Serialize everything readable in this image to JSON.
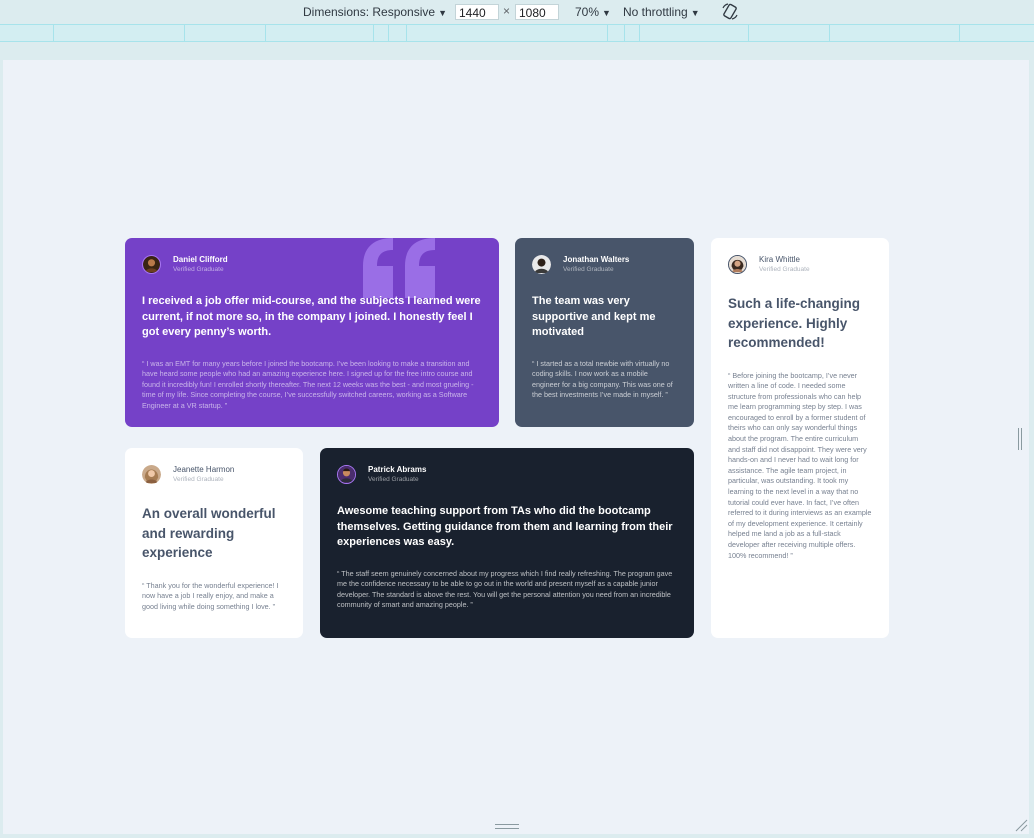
{
  "devtools": {
    "dimensions_label": "Dimensions: Responsive",
    "width_value": "1440",
    "height_value": "1080",
    "times": "×",
    "zoom": "70%",
    "throttling": "No throttling",
    "caret": "▼"
  },
  "testimonials": [
    {
      "name": "Daniel Clifford",
      "role": "Verified Graduate",
      "headline": "I received a job offer mid-course, and the subjects I learned were current, if not more so, in the company I joined. I honestly feel I got every penny’s worth.",
      "quote": "“ I was an EMT for many years before I joined the bootcamp. I’ve been looking to make a transition and have heard some people who had an amazing experience here. I signed up for the free intro course and found it incredibly fun! I enrolled shortly thereafter. The next 12 weeks was the best - and most grueling - time of my life. Since completing the course, I’ve successfully switched careers, working as a Software Engineer at a VR startup. ”"
    },
    {
      "name": "Jonathan Walters",
      "role": "Verified Graduate",
      "headline": "The team was very supportive and kept me motivated",
      "quote": "“ I started as a total newbie with virtually no coding skills. I now work as a mobile engineer for a big company. This was one of the best investments I’ve made in myself. ”"
    },
    {
      "name": "Kira Whittle",
      "role": "Verified Graduate",
      "headline": "Such a life-changing experience. Highly recommended!",
      "quote": "“ Before joining the bootcamp, I’ve never written a line of code. I needed some structure from professionals who can help me learn programming step by step. I was encouraged to enroll by a former student of theirs who can only say wonderful things about the program. The entire curriculum and staff did not disappoint. They were very hands-on and I never had to wait long for assistance. The agile team project, in particular, was outstanding. It took my learning to the next level in a way that no tutorial could ever have. In fact, I’ve often referred to it during interviews as an example of my development experience. It certainly helped me land a job as a full-stack developer after receiving multiple offers. 100% recommend! ”"
    },
    {
      "name": "Jeanette Harmon",
      "role": "Verified Graduate",
      "headline": "An overall wonderful and rewarding experience",
      "quote": "“ Thank you for the wonderful experience! I now have a job I really enjoy, and make a good living while doing something I love. ”"
    },
    {
      "name": "Patrick Abrams",
      "role": "Verified Graduate",
      "headline": "Awesome teaching support from TAs who did the bootcamp themselves. Getting guidance from them and learning from their experiences was easy.",
      "quote": "“ The staff seem genuinely concerned about my progress which I find really refreshing. The program gave me the confidence necessary to be able to go out in the world and present myself as a capable junior developer. The standard is above the rest. You will get the personal attention you need from an incredible community of smart and amazing people. ”"
    }
  ],
  "colors": {
    "purple": "#7541c8",
    "gray_blue": "#48556a",
    "dark": "#19212e",
    "white": "#ffffff",
    "page_bg": "#edf2f8",
    "devtools_bg": "#dcecef"
  },
  "icons": [
    "rotate-icon",
    "quote-mark-icon",
    "resize-handle-icon"
  ]
}
